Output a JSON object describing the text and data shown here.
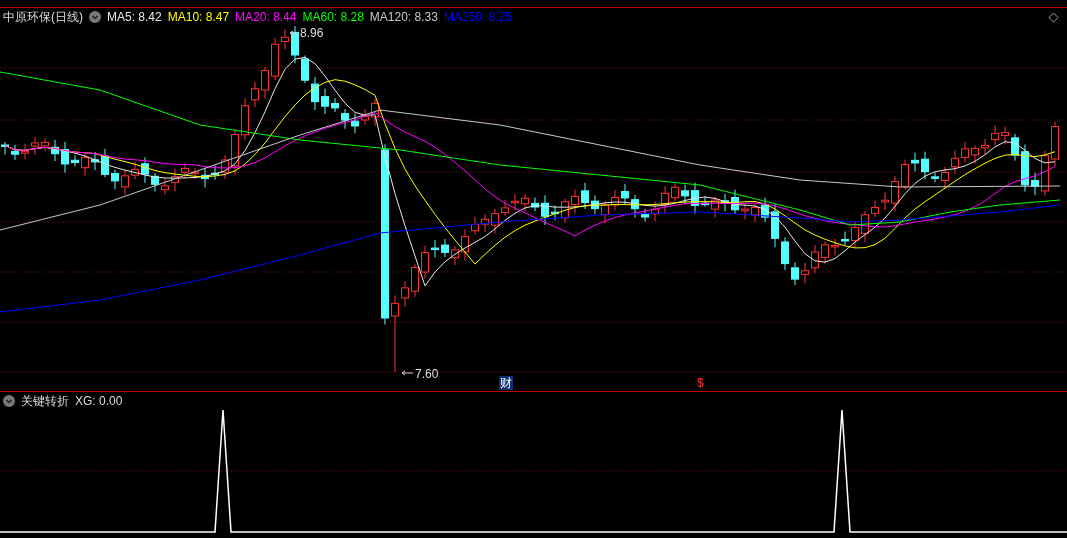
{
  "title": "中原环保(日线)",
  "moving_averages": [
    {
      "text": "MA5: 8.42",
      "color": "#e8e8e8"
    },
    {
      "text": "MA10: 8.47",
      "color": "#ffff00"
    },
    {
      "text": "MA20: 8.44",
      "color": "#ff00ff"
    },
    {
      "text": "MA60: 8.28",
      "color": "#00ff00"
    },
    {
      "text": "MA120: 8.33",
      "color": "#c8c8c8"
    },
    {
      "text": "MA250: 8.25",
      "color": "#0000ff"
    }
  ],
  "high_label": "8.96",
  "low_label": "7.60",
  "event_markers": [
    {
      "kind": "badge",
      "text": "财"
    },
    {
      "kind": "mark",
      "text": "$"
    }
  ],
  "indicator": {
    "name": "关键转折",
    "reading": "XG: 0.00"
  }
}
